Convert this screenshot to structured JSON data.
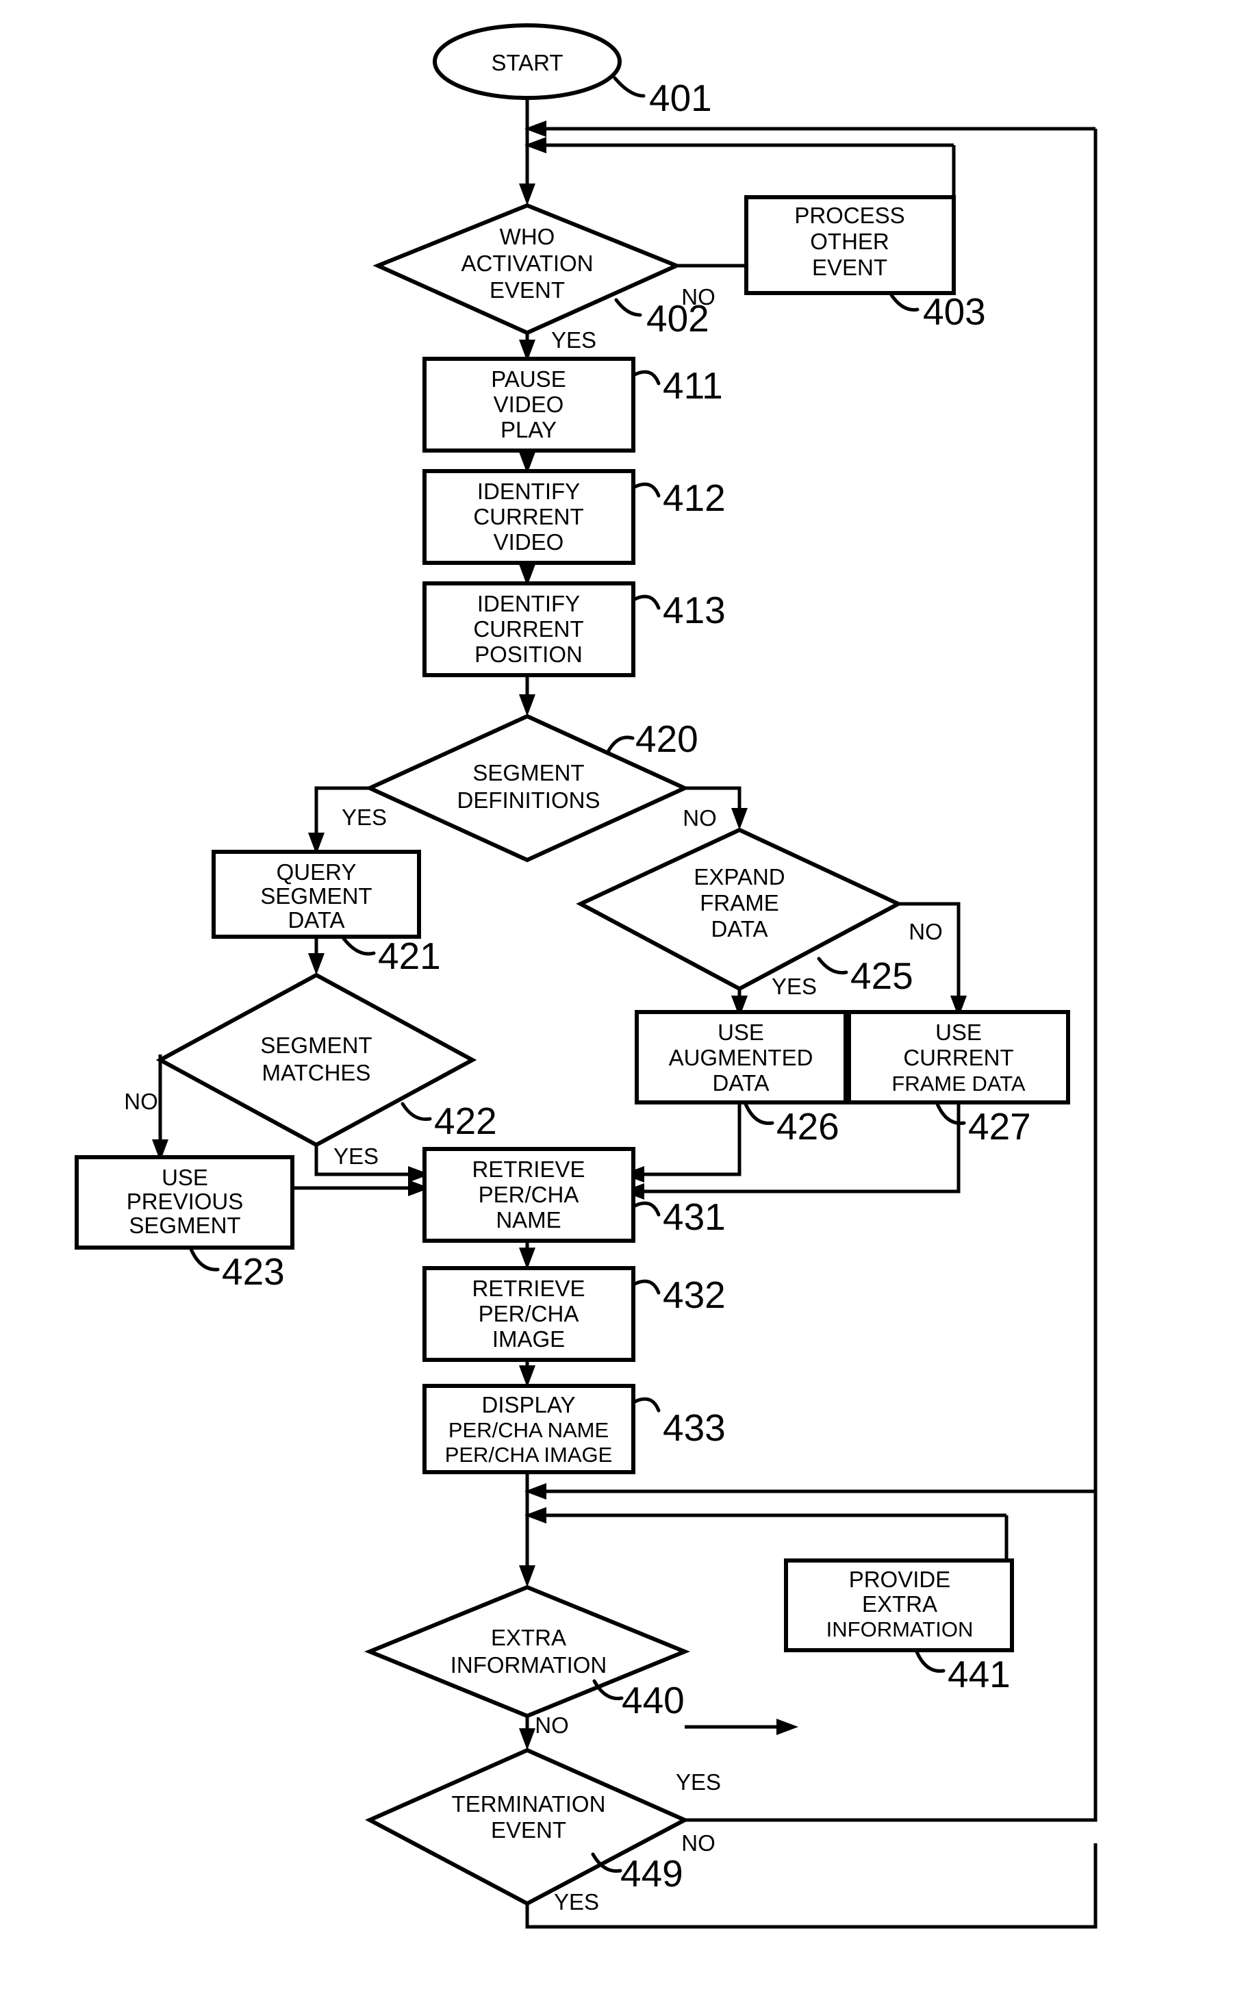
{
  "figure": {
    "type": "patent-flowchart",
    "background_color": "#ffffff",
    "line_color": "#000000"
  },
  "nodes": {
    "start": {
      "shape": "terminator",
      "label": "START",
      "ref": "401"
    },
    "who_activation_event": {
      "shape": "decision",
      "line1": "WHO",
      "line2": "ACTIVATION",
      "line3": "EVENT",
      "ref": "402"
    },
    "process_other_event": {
      "shape": "process",
      "line1": "PROCESS",
      "line2": "OTHER",
      "line3": "EVENT",
      "ref": "403"
    },
    "pause_video_play": {
      "shape": "process",
      "line1": "PAUSE",
      "line2": "VIDEO",
      "line3": "PLAY",
      "ref": "411"
    },
    "identify_current_video": {
      "shape": "process",
      "line1": "IDENTIFY",
      "line2": "CURRENT",
      "line3": "VIDEO",
      "ref": "412"
    },
    "identify_current_position": {
      "shape": "process",
      "line1": "IDENTIFY",
      "line2": "CURRENT",
      "line3": "POSITION",
      "ref": "413"
    },
    "segment_definitions": {
      "shape": "decision",
      "line1": "SEGMENT",
      "line2": "DEFINITIONS",
      "ref": "420"
    },
    "query_segment_data": {
      "shape": "process",
      "line1": "QUERY",
      "line2": "SEGMENT",
      "line3": "DATA",
      "ref": "421"
    },
    "segment_matches": {
      "shape": "decision",
      "line1": "SEGMENT",
      "line2": "MATCHES",
      "ref": "422"
    },
    "use_previous_segment": {
      "shape": "process",
      "line1": "USE",
      "line2": "PREVIOUS",
      "line3": "SEGMENT",
      "ref": "423"
    },
    "expand_frame_data": {
      "shape": "decision",
      "line1": "EXPAND",
      "line2": "FRAME",
      "line3": "DATA",
      "ref": "425"
    },
    "use_augmented_data": {
      "shape": "process",
      "line1": "USE",
      "line2": "AUGMENTED",
      "line3": "DATA",
      "ref": "426"
    },
    "use_current_frame_data": {
      "shape": "process",
      "line1": "USE",
      "line2": "CURRENT",
      "line3": "FRAME DATA",
      "ref": "427"
    },
    "retrieve_name": {
      "shape": "process",
      "line1": "RETRIEVE",
      "line2": "PER/CHA",
      "line3": "NAME",
      "ref": "431"
    },
    "retrieve_image": {
      "shape": "process",
      "line1": "RETRIEVE",
      "line2": "PER/CHA",
      "line3": "IMAGE",
      "ref": "432"
    },
    "display_name_image": {
      "shape": "process",
      "line1": "DISPLAY",
      "line2": "PER/CHA  NAME",
      "line3": "PER/CHA  IMAGE",
      "ref": "433"
    },
    "extra_information": {
      "shape": "decision",
      "line1": "EXTRA",
      "line2": "INFORMATION",
      "ref": "440"
    },
    "provide_extra_information": {
      "shape": "process",
      "line1": "PROVIDE",
      "line2": "EXTRA",
      "line3": "INFORMATION",
      "ref": "441"
    },
    "termination_event": {
      "shape": "decision",
      "line1": "TERMINATION",
      "line2": "EVENT",
      "ref": "449"
    }
  },
  "branch_labels": {
    "who_no": "NO",
    "who_yes": "YES",
    "segdef_yes": "YES",
    "segdef_no": "NO",
    "segmatch_no": "NO",
    "segmatch_yes": "YES",
    "expand_yes": "YES",
    "expand_no": "NO",
    "extra_yes": "YES",
    "extra_no": "NO",
    "term_no": "NO",
    "term_yes": "YES"
  }
}
